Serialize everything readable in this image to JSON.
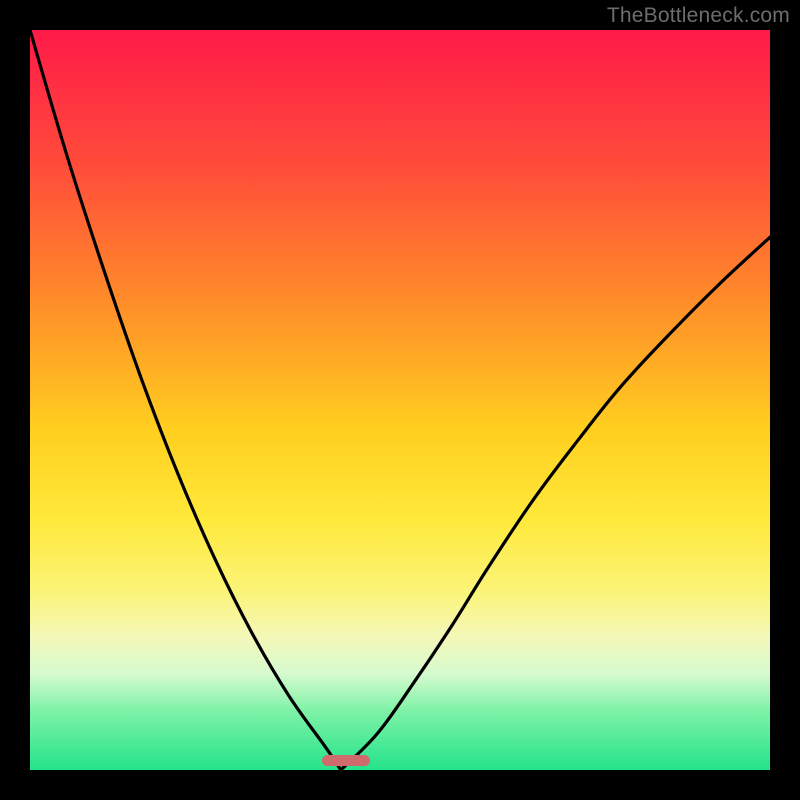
{
  "watermark": "TheBottleneck.com",
  "colors": {
    "frame": "#000000",
    "curve": "#000000",
    "marker": "#cf6b6d",
    "gradient_stops": [
      "#ff1a49",
      "#ff4b3a",
      "#ff8a2a",
      "#ffcf1f",
      "#ffe93a",
      "#fbf47a",
      "#f4f8b8",
      "#d6fbcf",
      "#7ef2a7",
      "#24e38a"
    ]
  },
  "layout": {
    "image_size": 800,
    "plot_margin": 30,
    "plot_size": 740
  },
  "marker": {
    "x_frac": 0.395,
    "width_frac": 0.065,
    "y_frac": 0.987
  },
  "chart_data": {
    "type": "line",
    "title": "",
    "xlabel": "",
    "ylabel": "",
    "xlim": [
      0,
      1
    ],
    "ylim": [
      0,
      1
    ],
    "note": "Axes are unlabeled in the source image; values are normalized fractions of the plot area, read from pixel positions. The curve is a V-shaped bottleneck profile with its minimum at x≈0.42. The left branch rises to the top-left corner; the right branch rises to roughly y≈0.72 at x=1.",
    "series": [
      {
        "name": "left-branch",
        "x": [
          0.0,
          0.05,
          0.1,
          0.15,
          0.2,
          0.25,
          0.3,
          0.35,
          0.4,
          0.42
        ],
        "y": [
          1.0,
          0.83,
          0.675,
          0.53,
          0.4,
          0.285,
          0.185,
          0.1,
          0.03,
          0.0
        ]
      },
      {
        "name": "right-branch",
        "x": [
          0.42,
          0.47,
          0.52,
          0.57,
          0.62,
          0.68,
          0.74,
          0.8,
          0.87,
          0.935,
          1.0
        ],
        "y": [
          0.0,
          0.05,
          0.12,
          0.195,
          0.275,
          0.365,
          0.445,
          0.52,
          0.595,
          0.66,
          0.72
        ]
      }
    ],
    "bottleneck_marker": {
      "x_start": 0.395,
      "x_end": 0.46,
      "y": 0.013
    }
  }
}
